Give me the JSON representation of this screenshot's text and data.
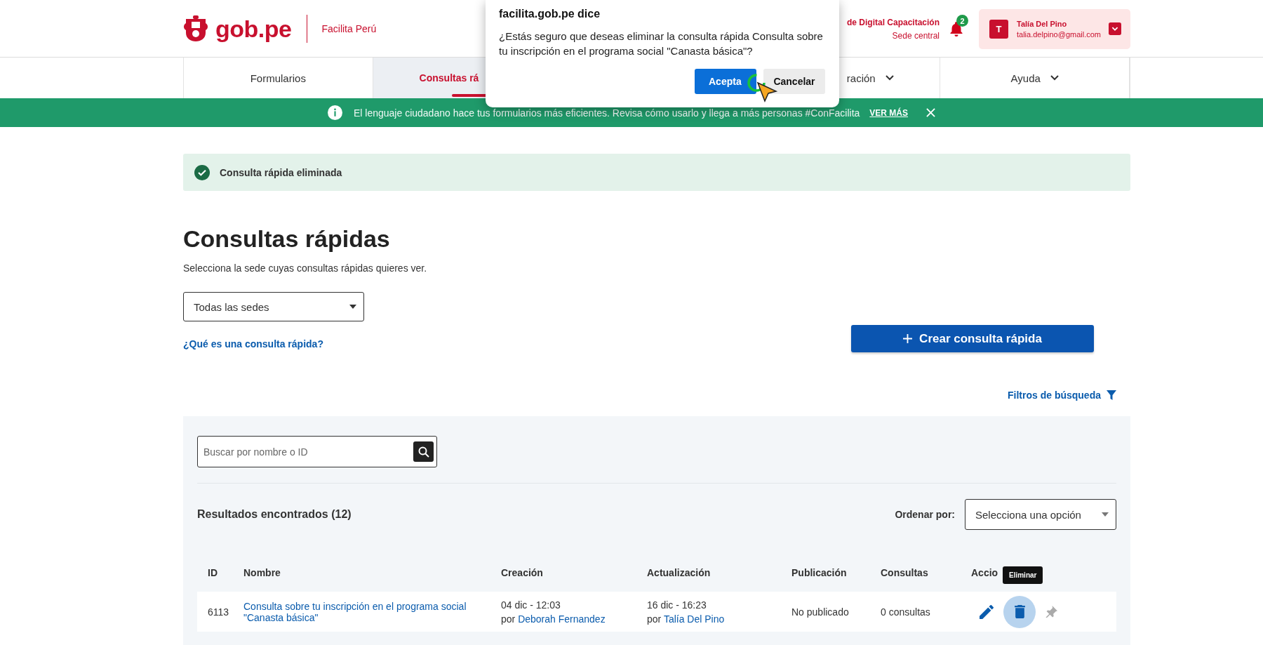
{
  "header": {
    "logo_text": "gob.pe",
    "product": "Facilita Perú",
    "entity": {
      "name": "de Digital Capacitación",
      "sede": "Sede central"
    },
    "notifications": {
      "count": "2"
    },
    "user": {
      "initial": "T",
      "name": "Talía Del Pino",
      "email": "talia.delpino@gmail.com"
    }
  },
  "nav": {
    "tabs": [
      {
        "label": "Formularios",
        "selected": false,
        "has_menu": false
      },
      {
        "label": "Consultas rá",
        "selected": true,
        "has_menu": false
      },
      {
        "label": "ración",
        "selected": false,
        "has_menu": true
      },
      {
        "label": "Ayuda",
        "selected": false,
        "has_menu": true
      }
    ]
  },
  "banner": {
    "text": "El lenguaje ciudadano hace tus formularios más eficientes. Revisa cómo usarlo y llega a más personas #ConFacilita",
    "link": "VER MÁS"
  },
  "alert": {
    "text": "Consulta rápida eliminada"
  },
  "page": {
    "title": "Consultas rápidas",
    "subtitle": "Selecciona la sede cuyas consultas rápidas quieres ver.",
    "sede_select": "Todas las sedes",
    "help_link": "¿Qué es una consulta rápida?",
    "create_button": "Crear consulta rápida",
    "filters_link": "Filtros de búsqueda"
  },
  "search": {
    "placeholder": "Buscar por nombre o ID"
  },
  "results": {
    "label": "Resultados encontrados (12)",
    "sort_label": "Ordenar por:",
    "sort_value": "Selecciona una opción"
  },
  "table": {
    "columns": [
      "ID",
      "Nombre",
      "Creación",
      "Actualización",
      "Publicación",
      "Consultas",
      "Accio"
    ],
    "rows": [
      {
        "id": "6113",
        "name": "Consulta sobre tu inscripción en el programa social \"Canasta básica\"",
        "created": {
          "date": "04 dic - 12:03",
          "prefix": "por",
          "author": "Deborah Fernandez"
        },
        "updated": {
          "date": "16 dic - 16:23",
          "prefix": "por",
          "author": "Talía Del Pino"
        },
        "publication": "No publicado",
        "queries": "0 consultas",
        "delete_hover": true
      }
    ]
  },
  "tooltip": {
    "text": "Eliminar"
  },
  "dialog": {
    "title": "facilita.gob.pe dice",
    "message": "¿Estás seguro que deseas eliminar la consulta rápida Consulta sobre tu inscripción en el programa social \"Canasta básica\"?",
    "buttons": [
      {
        "label": "Acepta",
        "kind": "primary"
      },
      {
        "label": "Cancelar",
        "kind": "secondary"
      }
    ]
  }
}
